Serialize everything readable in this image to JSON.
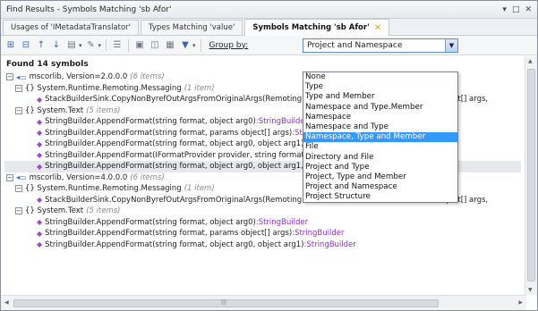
{
  "window": {
    "title": "Find Results - Symbols Matching 'sb Afor'",
    "controls": [
      "▾",
      "□",
      "✕"
    ]
  },
  "tabs": [
    {
      "label": "Usages of 'IMetadataTranslator'"
    },
    {
      "label": "Types Matching 'value'"
    },
    {
      "label": "Symbols Matching 'sb Afor'",
      "close": "✕"
    }
  ],
  "toolbar": {
    "group_by_label": "Group by:",
    "group_by_value": "Project and Namespace"
  },
  "results": {
    "found_label": "Found 14 symbols",
    "rows": [
      {
        "text": "mscorlib, Version=2.0.0.0",
        "muted": "(6 items)",
        "ret": "",
        "exp": "−",
        "icon": "◂▭"
      },
      {
        "text": "{} System.Runtime.Remoting.Messaging",
        "muted": "(1 item)",
        "ret": "",
        "exp": "−",
        "icon": ""
      },
      {
        "text": "StackBuilderSink.CopyNonByrefOutArgsFromOriginalArgs(RemotingMethodCachedData methodCache, object[] args,",
        "muted": "",
        "ret": "",
        "exp": "",
        "icon": "◆"
      },
      {
        "text": "{} System.Text",
        "muted": "(5 items)",
        "ret": "",
        "exp": "−",
        "icon": ""
      },
      {
        "text": "StringBuilder.AppendFormat(string format, object arg0)",
        "muted": "",
        "ret": ":StringBuilder",
        "exp": "",
        "icon": "◆"
      },
      {
        "text": "StringBuilder.AppendFormat(string format, params object[] args)",
        "muted": "",
        "ret": ":StringBuilder",
        "exp": "",
        "icon": "◆"
      },
      {
        "text": "StringBuilder.AppendFormat(string format, object arg0, object arg1)",
        "muted": "",
        "ret": ":StringBuilder",
        "exp": "",
        "icon": "◆"
      },
      {
        "text": "StringBuilder.AppendFormat(IFormatProvider provider, string format, params object[] args)",
        "muted": "",
        "ret": ":StringBuilder",
        "exp": "",
        "icon": "◆"
      },
      {
        "text": "StringBuilder.AppendFormat(string format, object arg0, object arg1, object arg2)",
        "muted": "",
        "ret": ":StringBuilder",
        "exp": "",
        "icon": "◆"
      },
      {
        "text": "mscorlib, Version=4.0.0.0",
        "muted": "(6 items)",
        "ret": "",
        "exp": "−",
        "icon": "◂▭"
      },
      {
        "text": "{} System.Runtime.Remoting.Messaging",
        "muted": "(1 item)",
        "ret": "",
        "exp": "−",
        "icon": ""
      },
      {
        "text": "StackBuilderSink.CopyNonByrefOutArgsFromOriginalArgs(RemotingMethodCachedData methodCache, object[] args,",
        "muted": "",
        "ret": "",
        "exp": "",
        "icon": "◆"
      },
      {
        "text": "{} System.Text",
        "muted": "(5 items)",
        "ret": "",
        "exp": "−",
        "icon": ""
      },
      {
        "text": "StringBuilder.AppendFormat(string format, object arg0)",
        "muted": "",
        "ret": ":StringBuilder",
        "exp": "",
        "icon": "◆"
      },
      {
        "text": "StringBuilder.AppendFormat(string format, params object[] args)",
        "muted": "",
        "ret": ":StringBuilder",
        "exp": "",
        "icon": "◆"
      },
      {
        "text": "StringBuilder.AppendFormat(string format, object arg0, object arg1)",
        "muted": "",
        "ret": ":StringBuilder",
        "exp": "",
        "icon": "◆"
      }
    ]
  },
  "dropdown": {
    "options": [
      "None",
      "Type",
      "Type and Member",
      "Namespace and Type.Member",
      "Namespace",
      "Namespace and Type",
      "Namespace, Type and Member",
      "File",
      "Directory and File",
      "Project and Type",
      "Project, Type and Member",
      "Project and Namespace",
      "Project Structure"
    ],
    "selected_index": 6
  },
  "scrollbar": {
    "grip": "|||"
  },
  "colors": {
    "accent": "#3399ff",
    "return_type": "#8b2fc9",
    "method_icon": "#9b4bc4"
  }
}
